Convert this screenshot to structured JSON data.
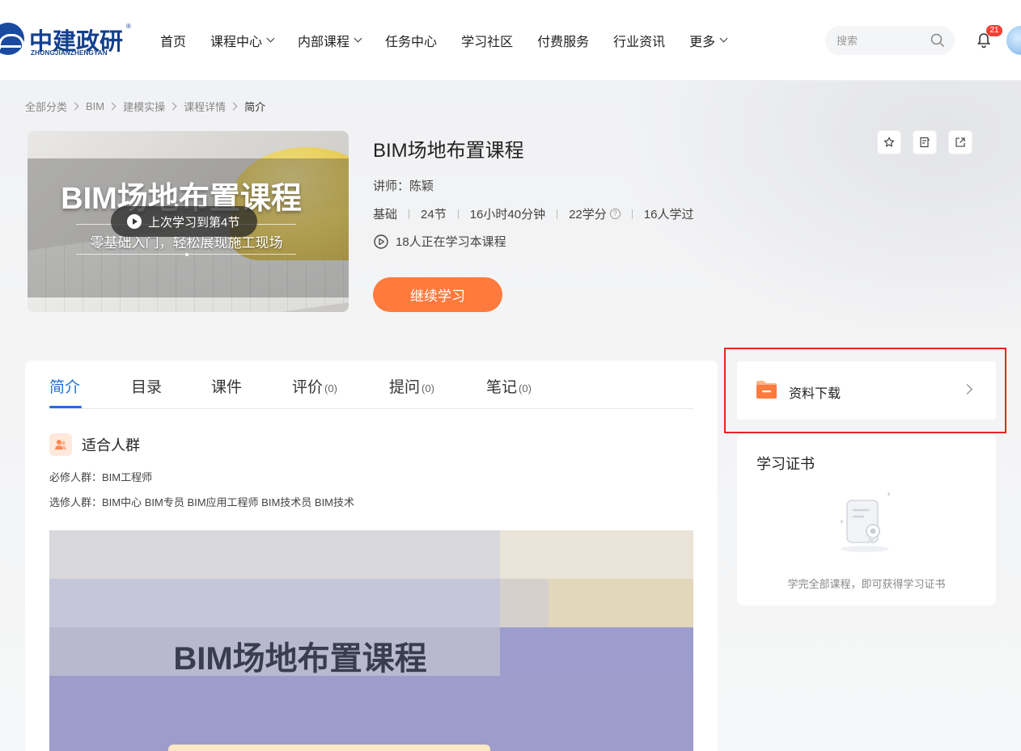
{
  "logo": {
    "cn": "中建政研",
    "en": "ZHONGJIANZHENGYAN",
    "reg": "®"
  },
  "nav": [
    {
      "label": "首页",
      "dropdown": false
    },
    {
      "label": "课程中心",
      "dropdown": true
    },
    {
      "label": "内部课程",
      "dropdown": true
    },
    {
      "label": "任务中心",
      "dropdown": false
    },
    {
      "label": "学习社区",
      "dropdown": false
    },
    {
      "label": "付费服务",
      "dropdown": false
    },
    {
      "label": "行业资讯",
      "dropdown": false
    },
    {
      "label": "更多",
      "dropdown": true
    }
  ],
  "search": {
    "placeholder": "搜索"
  },
  "notifications": {
    "count": "21"
  },
  "breadcrumb": [
    "全部分类",
    "BIM",
    "建模实操",
    "课程详情",
    "简介"
  ],
  "cover": {
    "title": "BIM场地布置课程",
    "subtitle": "零基础入门，轻松展现施工现场",
    "resume_label": "上次学习到第4节"
  },
  "course": {
    "title": "BIM场地布置课程",
    "teacher": "讲师：陈颖",
    "level": "基础",
    "lessons": "24节",
    "duration": "16小时40分钟",
    "credits": "22学分",
    "learners": "16人学过",
    "learning_now": "18人正在学习本课程",
    "continue_label": "继续学习"
  },
  "tabs": [
    {
      "label": "简介",
      "count": ""
    },
    {
      "label": "目录",
      "count": ""
    },
    {
      "label": "课件",
      "count": ""
    },
    {
      "label": "评价",
      "count": "(0)"
    },
    {
      "label": "提问",
      "count": "(0)"
    },
    {
      "label": "笔记",
      "count": "(0)"
    }
  ],
  "audience": {
    "title": "适合人群",
    "required": "必修人群：BIM工程师",
    "elective": "选修人群：BIM中心 BIM专员 BIM应用工程师 BIM技术员 BIM技术"
  },
  "banner": {
    "title": "BIM场地布置课程"
  },
  "download": {
    "label": "资料下载"
  },
  "certificate": {
    "title": "学习证书",
    "hint": "学完全部课程，即可获得学习证书"
  },
  "colors": {
    "accent": "#1f6fd9",
    "orange": "#ff7a3d",
    "highlight": "#e8261f",
    "brand": "#12408f"
  }
}
